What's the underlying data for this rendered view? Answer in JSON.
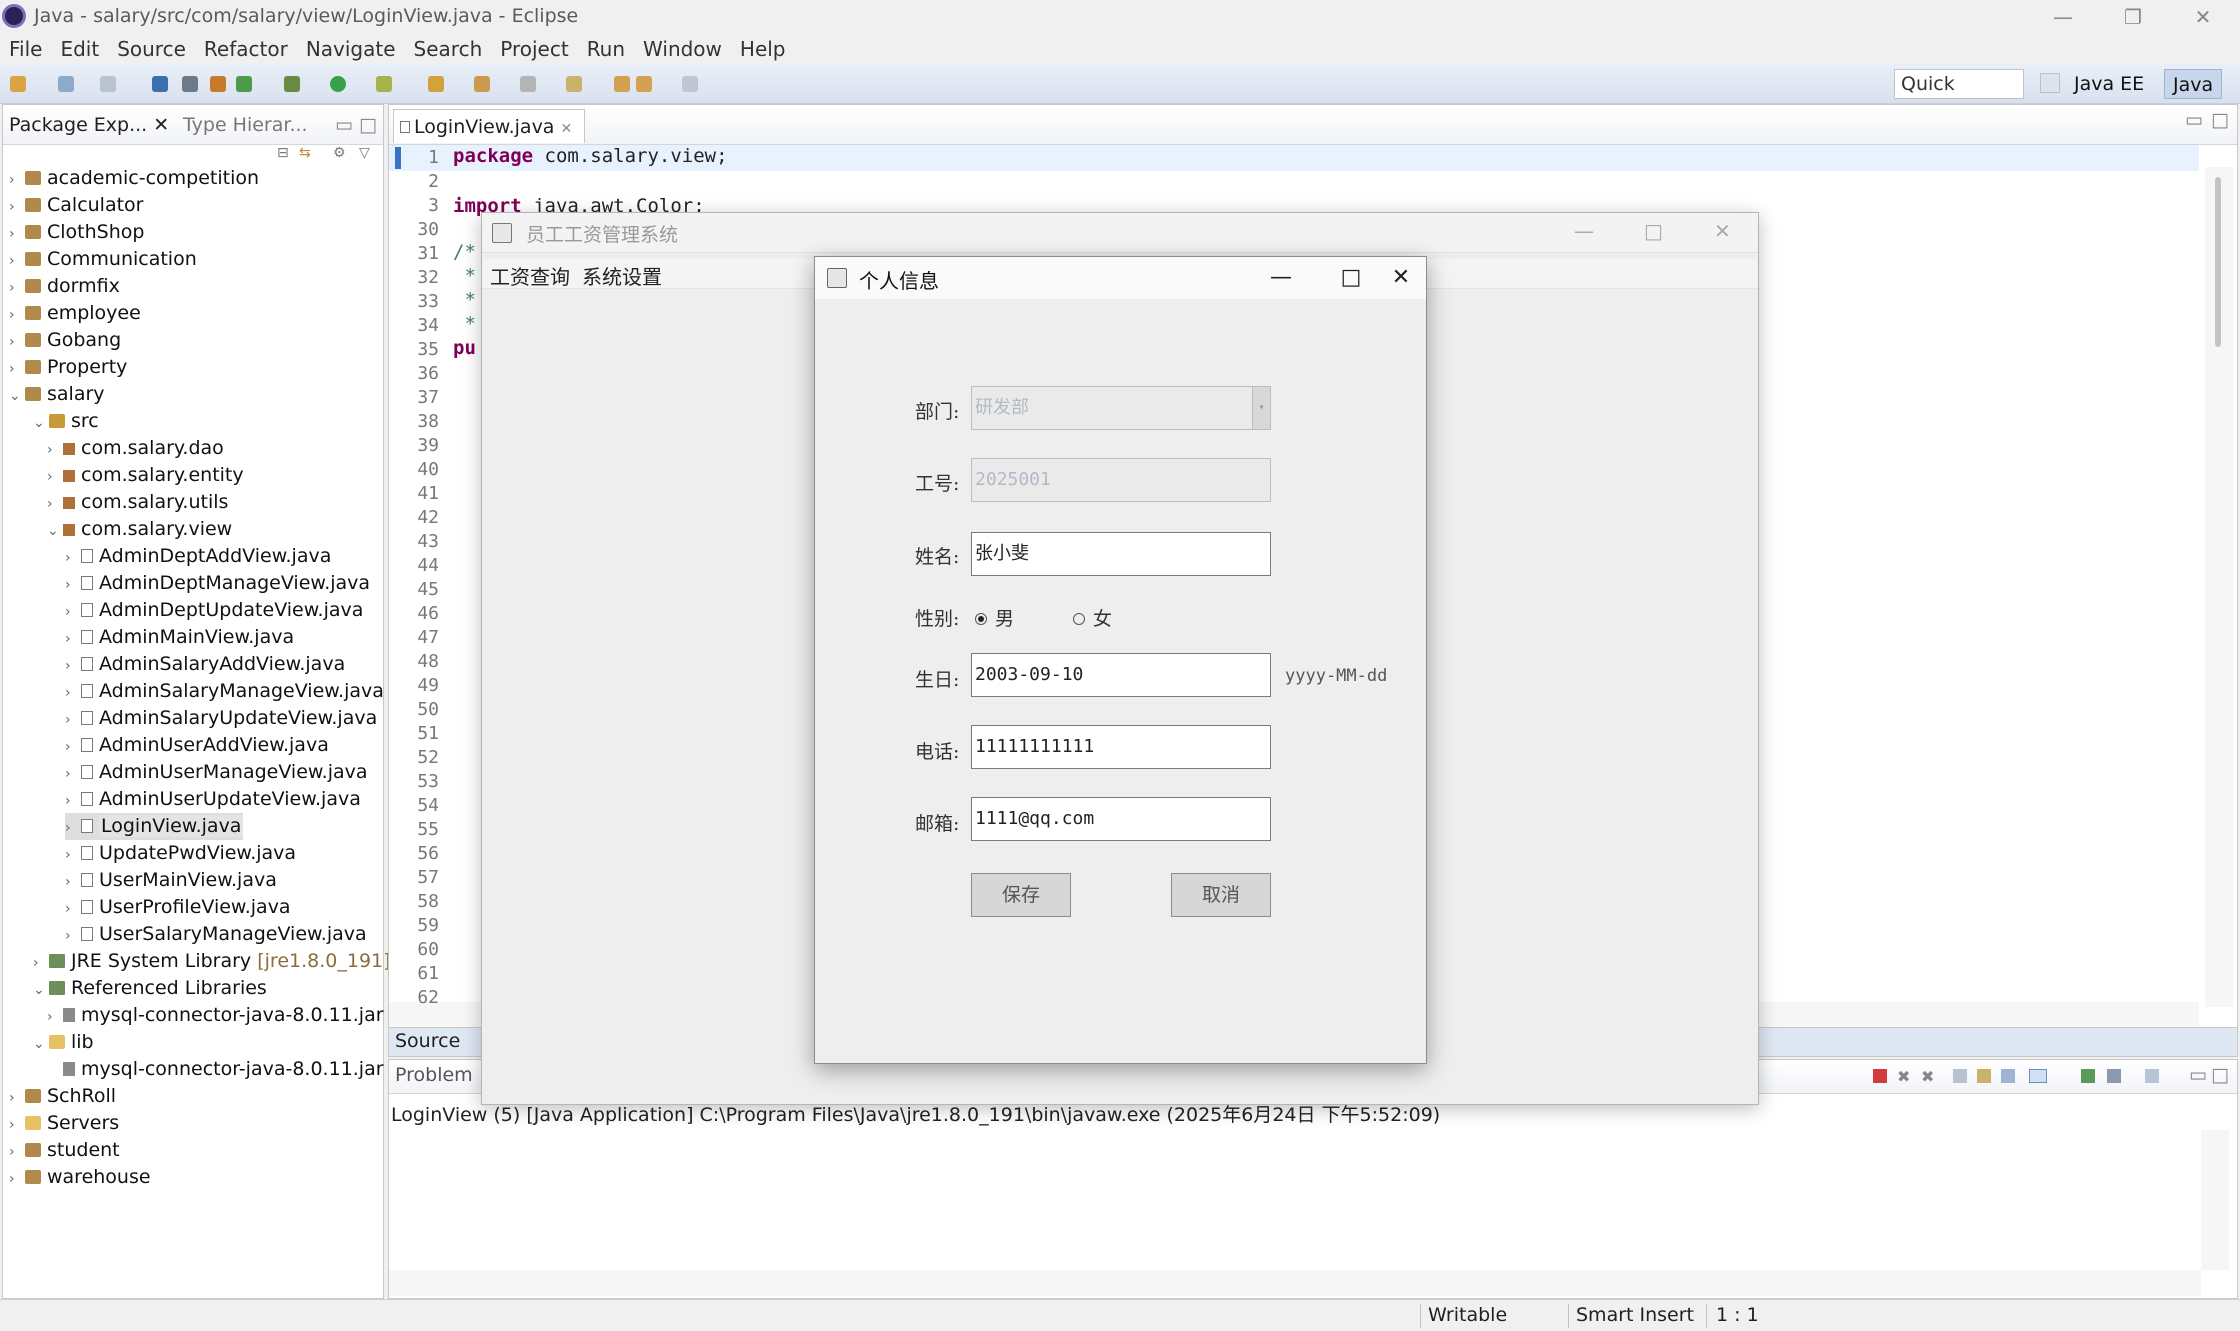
{
  "window": {
    "title": "Java - salary/src/com/salary/view/LoginView.java - Eclipse",
    "minimize": "—",
    "restore": "❐",
    "close": "✕"
  },
  "menubar": [
    "File",
    "Edit",
    "Source",
    "Refactor",
    "Navigate",
    "Search",
    "Project",
    "Run",
    "Window",
    "Help"
  ],
  "toolbar": {
    "quick_access": "Quick Access",
    "perspectives": [
      "Java EE",
      "Java"
    ]
  },
  "package_explorer": {
    "tab_label": "Package Exp...",
    "tab2_label": "Type Hierar...",
    "tree": [
      {
        "label": "academic-competition",
        "level": 0,
        "expanded": false,
        "kind": "proj"
      },
      {
        "label": "Calculator",
        "level": 0,
        "expanded": false,
        "kind": "proj"
      },
      {
        "label": "ClothShop",
        "level": 0,
        "expanded": false,
        "kind": "proj"
      },
      {
        "label": "Communication",
        "level": 0,
        "expanded": false,
        "kind": "proj"
      },
      {
        "label": "dormfix",
        "level": 0,
        "expanded": false,
        "kind": "proj"
      },
      {
        "label": "employee",
        "level": 0,
        "expanded": false,
        "kind": "proj"
      },
      {
        "label": "Gobang",
        "level": 0,
        "expanded": false,
        "kind": "proj"
      },
      {
        "label": "Property",
        "level": 0,
        "expanded": false,
        "kind": "proj"
      },
      {
        "label": "salary",
        "level": 0,
        "expanded": true,
        "kind": "proj"
      },
      {
        "label": "src",
        "level": 1,
        "expanded": true,
        "kind": "src"
      },
      {
        "label": "com.salary.dao",
        "level": 2,
        "expanded": false,
        "kind": "pkgi"
      },
      {
        "label": "com.salary.entity",
        "level": 2,
        "expanded": false,
        "kind": "pkgi"
      },
      {
        "label": "com.salary.utils",
        "level": 2,
        "expanded": false,
        "kind": "pkgi"
      },
      {
        "label": "com.salary.view",
        "level": 2,
        "expanded": true,
        "kind": "pkgi"
      },
      {
        "label": "AdminDeptAddView.java",
        "level": 3,
        "expanded": false,
        "kind": "file"
      },
      {
        "label": "AdminDeptManageView.java",
        "level": 3,
        "expanded": false,
        "kind": "file"
      },
      {
        "label": "AdminDeptUpdateView.java",
        "level": 3,
        "expanded": false,
        "kind": "file"
      },
      {
        "label": "AdminMainView.java",
        "level": 3,
        "expanded": false,
        "kind": "file"
      },
      {
        "label": "AdminSalaryAddView.java",
        "level": 3,
        "expanded": false,
        "kind": "file"
      },
      {
        "label": "AdminSalaryManageView.java",
        "level": 3,
        "expanded": false,
        "kind": "file"
      },
      {
        "label": "AdminSalaryUpdateView.java",
        "level": 3,
        "expanded": false,
        "kind": "file"
      },
      {
        "label": "AdminUserAddView.java",
        "level": 3,
        "expanded": false,
        "kind": "file"
      },
      {
        "label": "AdminUserManageView.java",
        "level": 3,
        "expanded": false,
        "kind": "file"
      },
      {
        "label": "AdminUserUpdateView.java",
        "level": 3,
        "expanded": false,
        "kind": "file"
      },
      {
        "label": "LoginView.java",
        "level": 3,
        "expanded": false,
        "kind": "file",
        "selected": true
      },
      {
        "label": "UpdatePwdView.java",
        "level": 3,
        "expanded": false,
        "kind": "file"
      },
      {
        "label": "UserMainView.java",
        "level": 3,
        "expanded": false,
        "kind": "file"
      },
      {
        "label": "UserProfileView.java",
        "level": 3,
        "expanded": false,
        "kind": "file"
      },
      {
        "label": "UserSalaryManageView.java",
        "level": 3,
        "expanded": false,
        "kind": "file"
      },
      {
        "label": "JRE System Library",
        "suffix": "[jre1.8.0_191]",
        "level": 1,
        "expanded": false,
        "kind": "lib"
      },
      {
        "label": "Referenced Libraries",
        "level": 1,
        "expanded": true,
        "kind": "lib"
      },
      {
        "label": "mysql-connector-java-8.0.11.jar",
        "level": 2,
        "expanded": false,
        "kind": "jar"
      },
      {
        "label": "lib",
        "level": 1,
        "expanded": true,
        "kind": "fold"
      },
      {
        "label": "mysql-connector-java-8.0.11.jar",
        "level": 2,
        "expanded": null,
        "kind": "jar"
      },
      {
        "label": "SchRoll",
        "level": 0,
        "expanded": false,
        "kind": "proj"
      },
      {
        "label": "Servers",
        "level": 0,
        "expanded": false,
        "kind": "fold"
      },
      {
        "label": "student",
        "level": 0,
        "expanded": false,
        "kind": "proj"
      },
      {
        "label": "warehouse",
        "level": 0,
        "expanded": false,
        "kind": "proj"
      }
    ]
  },
  "editor": {
    "tab_label": "LoginView.java",
    "line_numbers": [
      "1",
      "2",
      "3",
      "30",
      "31",
      "32",
      "33",
      "34",
      "35",
      "36",
      "37",
      "38",
      "39",
      "40",
      "41",
      "42",
      "43",
      "44",
      "45",
      "46",
      "47",
      "48",
      "49",
      "50",
      "51",
      "52",
      "53",
      "54",
      "55",
      "56",
      "57",
      "58",
      "59",
      "60",
      "61",
      "62"
    ],
    "code": {
      "line1_kw": "package",
      "line1_rest": " com.salary.view;",
      "line3_kw": "import",
      "line3_rest": " java.awt.Color;",
      "line31": "/*",
      "line32": " *",
      "line33": " *",
      "line34": " *",
      "line35_kw": "pu"
    },
    "source_tab": "Source"
  },
  "console": {
    "tab_label": "Problem",
    "line": "LoginView (5) [Java Application] C:\\Program Files\\Java\\jre1.8.0_191\\bin\\javaw.exe (2025年6月24日 下午5:52:09)"
  },
  "statusbar": {
    "writable": "Writable",
    "insert": "Smart Insert",
    "position": "1 : 1"
  },
  "main_window": {
    "title": "员工工资管理系统",
    "menus": [
      "工资查询",
      "系统设置"
    ]
  },
  "dialog": {
    "title": "个人信息",
    "dept_label": "部门:",
    "dept_value": "研发部",
    "id_label": "工号:",
    "id_value": "2025001",
    "name_label": "姓名:",
    "name_value": "张小斐",
    "gender_label": "性别:",
    "gender_male": "男",
    "gender_female": "女",
    "birthday_label": "生日:",
    "birthday_value": "2003-09-10",
    "birthday_hint": "yyyy-MM-dd",
    "phone_label": "电话:",
    "phone_value": "11111111111",
    "email_label": "邮箱:",
    "email_value": "1111@qq.com",
    "save_label": "保存",
    "cancel_label": "取消"
  }
}
